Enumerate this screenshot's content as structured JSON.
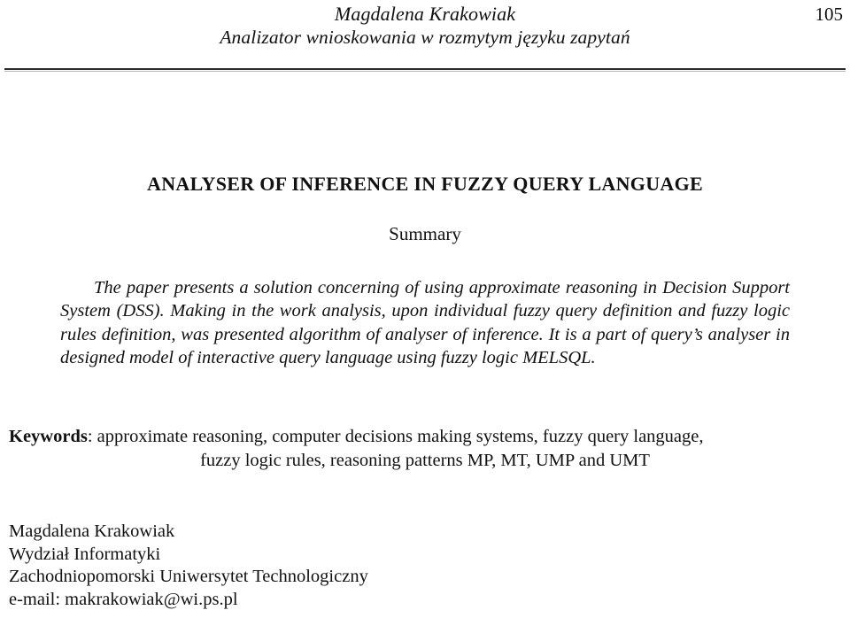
{
  "running_head": {
    "author": "Magdalena Krakowiak",
    "article_title_pl": "Analizator wnioskowania w rozmytym języku zapytań",
    "page_number": "105"
  },
  "article": {
    "title": "ANALYSER OF INFERENCE IN FUZZY QUERY LANGUAGE",
    "summary_heading": "Summary",
    "summary_text": "The paper presents a solution concerning of using approximate reasoning in Decision Support System (DSS). Making in the work analysis, upon individual fuzzy query definition and fuzzy logic rules definition, was presented algorithm of analyser of inference. It is a part of query’s analyser in designed model of interactive query language using fuzzy logic MELSQL."
  },
  "keywords": {
    "label": "Keywords",
    "separator": ": ",
    "line1": "approximate reasoning, computer decisions making systems, fuzzy query language,",
    "line2": "fuzzy logic rules, reasoning patterns MP, MT, UMP and UMT"
  },
  "affiliation": {
    "name": "Magdalena Krakowiak",
    "faculty": "Wydział Informatyki",
    "institution": "Zachodniopomorski Uniwersytet Technologiczny",
    "email_line": "e-mail: makrakowiak@wi.ps.pl"
  },
  "colors": {
    "text": "#111111",
    "rule": "#2b2b2b",
    "background": "#ffffff"
  }
}
